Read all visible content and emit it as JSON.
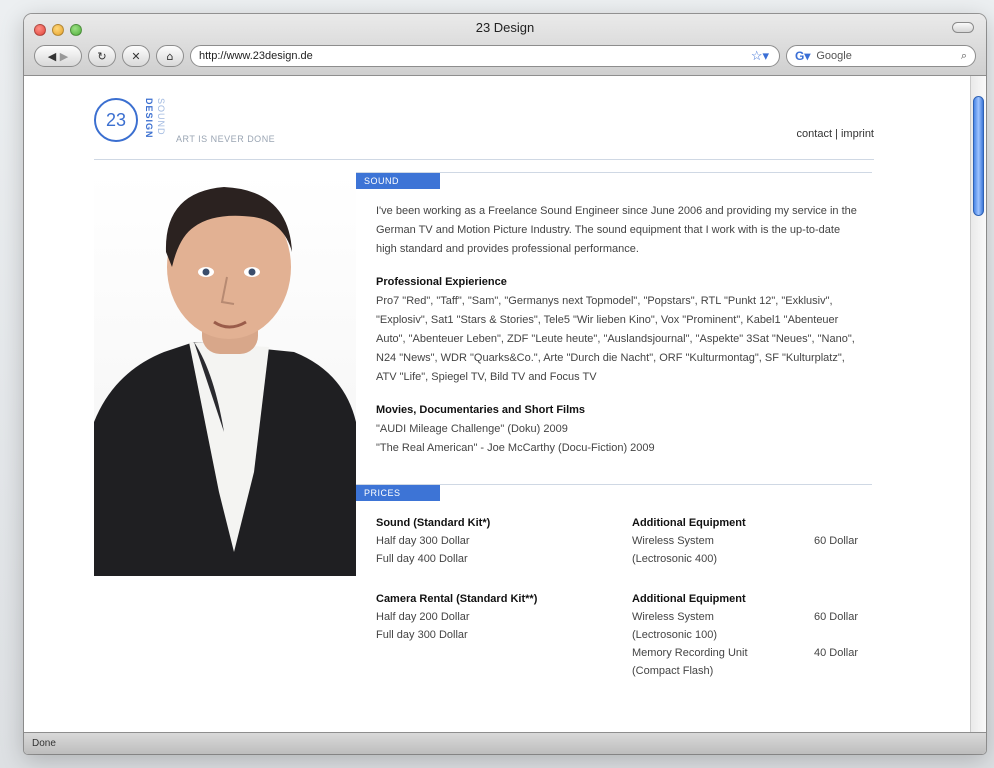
{
  "window": {
    "title": "23 Design",
    "url": "http://www.23design.de",
    "search_placeholder": "Google",
    "status": "Done"
  },
  "header": {
    "logo_number": "23",
    "logo_vertical_1": "DESIGN",
    "logo_vertical_2": "SOUND",
    "tagline": "ART IS NEVER DONE",
    "nav_contact": "contact",
    "nav_separator": "|",
    "nav_imprint": "imprint"
  },
  "sound": {
    "tab": "SOUND",
    "intro": "I've been working as a Freelance Sound Engineer since June 2006 and providing my service in the German TV and Motion Picture Industry. The sound equipment that I work with is the up-to-date high standard and provides professional performance.",
    "experience_heading": "Professional Expierience",
    "experience_text": "Pro7 \"Red\", \"Taff\", \"Sam\", \"Germanys next Topmodel\", \"Popstars\", RTL \"Punkt 12\", \"Exklusiv\", \"Explosiv\", Sat1 \"Stars & Stories\", Tele5 \"Wir lieben Kino\", Vox \"Prominent\", Kabel1 \"Abenteuer Auto\", \"Abenteuer Leben\", ZDF \"Leute heute\", \"Auslandsjournal\", \"Aspekte\" 3Sat \"Neues\", \"Nano\", N24 \"News\", WDR \"Quarks&Co.\", Arte \"Durch die Nacht\", ORF \"Kulturmontag\", SF \"Kulturplatz\", ATV \"Life\", Spiegel TV, Bild TV and Focus TV",
    "movies_heading": "Movies, Documentaries and Short Films",
    "movies": [
      "\"AUDI Mileage Challenge\" (Doku) 2009",
      "\"The Real American\" - Joe McCarthy (Docu-Fiction) 2009"
    ]
  },
  "prices": {
    "tab": "PRICES",
    "left": [
      {
        "heading": "Sound (Standard Kit*)",
        "lines": [
          "Half day 300 Dollar",
          "Full day 400 Dollar"
        ]
      },
      {
        "heading": "Camera Rental (Standard Kit**)",
        "lines": [
          "Half day 200 Dollar",
          "Full day 300 Dollar"
        ]
      }
    ],
    "right": [
      {
        "heading": "Additional Equipment",
        "rows": [
          {
            "label": "Wireless System (Lectrosonic 400)",
            "price": "60 Dollar"
          }
        ]
      },
      {
        "heading": "Additional Equipment",
        "rows": [
          {
            "label": "Wireless System (Lectrosonic 100)",
            "price": "60 Dollar"
          },
          {
            "label": "Memory Recording Unit (Compact Flash)",
            "price": "40 Dollar"
          }
        ]
      }
    ]
  },
  "colors": {
    "accent": "#3d74d6",
    "scroll_thumb": "#4a86e6"
  },
  "icons": [
    "back-icon",
    "forward-icon",
    "reload-icon",
    "stop-icon",
    "home-icon",
    "bookmark-star-icon",
    "search-icon"
  ]
}
